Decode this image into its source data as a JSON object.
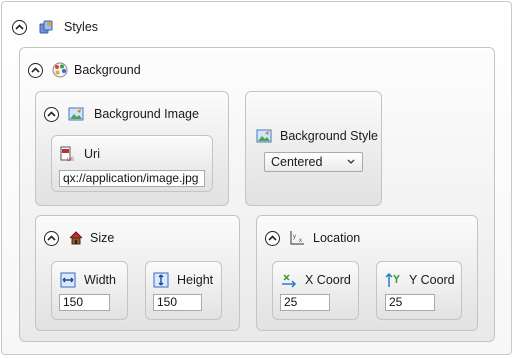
{
  "styles": {
    "title": "Styles",
    "icon": "styles-icon"
  },
  "background": {
    "title": "Background",
    "icon": "background-palette-icon",
    "image": {
      "title": "Background Image",
      "icon": "picture-icon",
      "uri": {
        "label": "Uri",
        "icon": "uri-file-icon",
        "value": "qx://application/image.jpg"
      }
    },
    "style": {
      "label": "Background Style",
      "icon": "picture-icon",
      "selected": "Centered"
    },
    "size": {
      "title": "Size",
      "icon": "house-size-icon",
      "width": {
        "label": "Width",
        "icon": "horizontal-resize-icon",
        "value": "150"
      },
      "height": {
        "label": "Height",
        "icon": "vertical-resize-icon",
        "value": "150"
      }
    },
    "location": {
      "title": "Location",
      "icon": "xy-coordinates-icon",
      "x": {
        "label": "X Coord",
        "icon": "x-coordinate-icon",
        "value": "25"
      },
      "y": {
        "label": "Y Coord",
        "icon": "y-coordinate-icon",
        "value": "25"
      }
    }
  }
}
